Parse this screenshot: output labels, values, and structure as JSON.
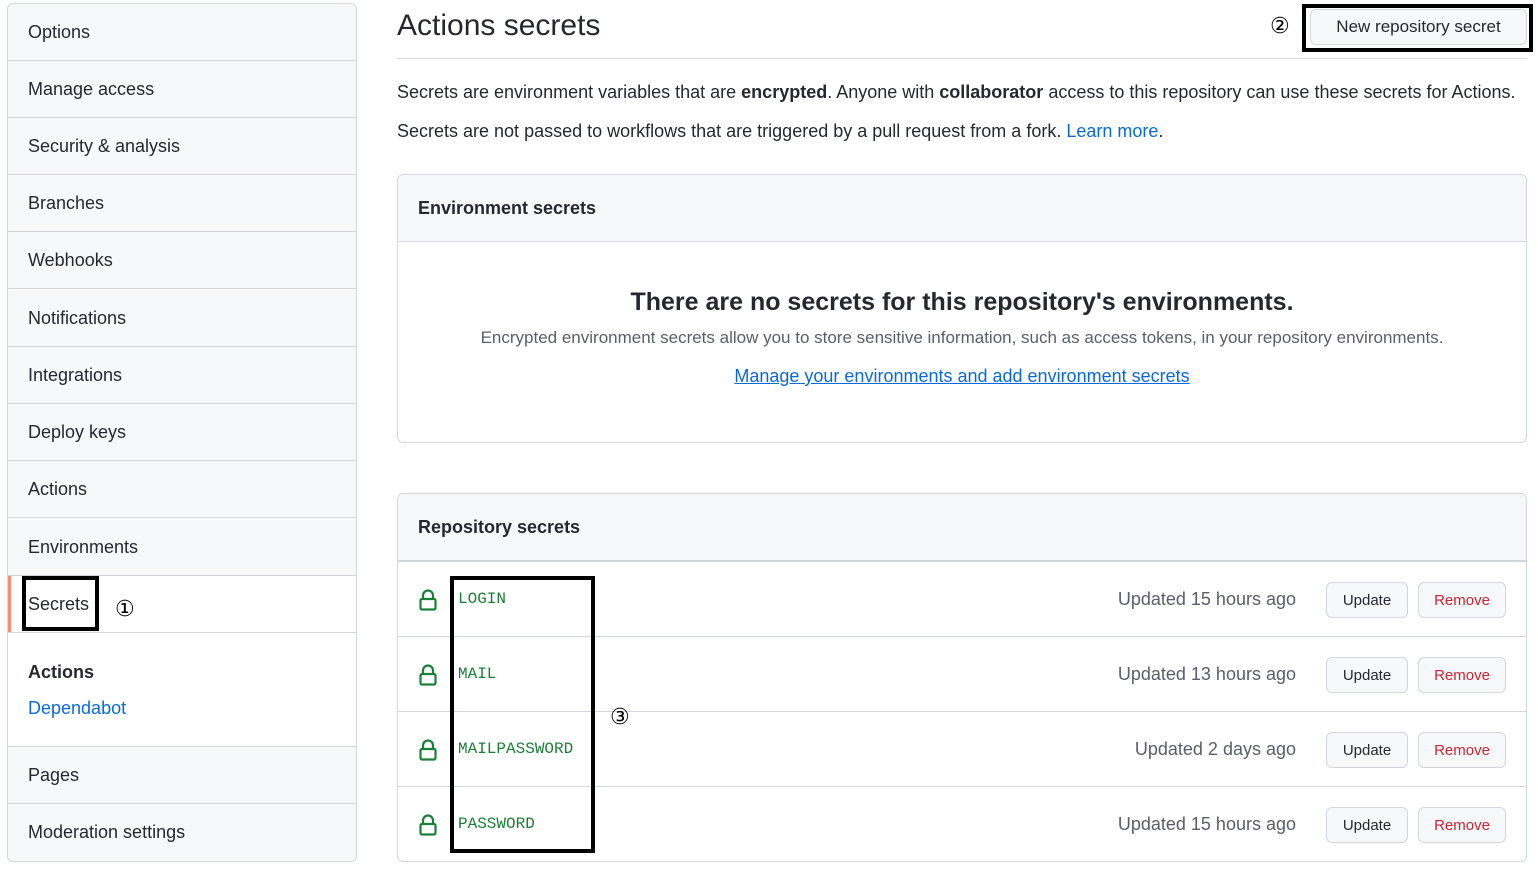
{
  "sidebar": {
    "items": [
      {
        "label": "Options"
      },
      {
        "label": "Manage access"
      },
      {
        "label": "Security & analysis"
      },
      {
        "label": "Branches"
      },
      {
        "label": "Webhooks"
      },
      {
        "label": "Notifications"
      },
      {
        "label": "Integrations"
      },
      {
        "label": "Deploy keys"
      },
      {
        "label": "Actions"
      },
      {
        "label": "Environments"
      },
      {
        "label": "Secrets",
        "selected": true
      }
    ],
    "secrets_group": {
      "title": "Actions",
      "link": "Dependabot"
    },
    "bottom_items": [
      {
        "label": "Pages"
      },
      {
        "label": "Moderation settings"
      }
    ]
  },
  "annotations": {
    "one": "①",
    "two": "②",
    "three": "③"
  },
  "header": {
    "title": "Actions secrets",
    "new_button": "New repository secret"
  },
  "description": {
    "line1_a": "Secrets are environment variables that are ",
    "line1_b": "encrypted",
    "line1_c": ". Anyone with ",
    "line1_d": "collaborator",
    "line1_e": " access to this repository can use these secrets for Actions.",
    "line2_a": "Secrets are not passed to workflows that are triggered by a pull request from a fork. ",
    "line2_link": "Learn more",
    "line2_end": "."
  },
  "environment_secrets": {
    "header": "Environment secrets",
    "blank_title": "There are no secrets for this repository's environments.",
    "blank_text": "Encrypted environment secrets allow you to store sensitive information, such as access tokens, in your repository environments.",
    "blank_link": "Manage your environments and add environment secrets"
  },
  "repository_secrets": {
    "header": "Repository secrets",
    "update_label": "Update",
    "remove_label": "Remove",
    "rows": [
      {
        "name": "LOGIN",
        "updated": "Updated 15 hours ago"
      },
      {
        "name": "MAIL",
        "updated": "Updated 13 hours ago"
      },
      {
        "name": "MAILPASSWORD",
        "updated": "Updated 2 days ago"
      },
      {
        "name": "PASSWORD",
        "updated": "Updated 15 hours ago"
      }
    ]
  },
  "colors": {
    "link": "#0969da",
    "secret_name": "#1a7f37",
    "remove": "#cf222e",
    "selected_marker": "#fd8c73"
  }
}
